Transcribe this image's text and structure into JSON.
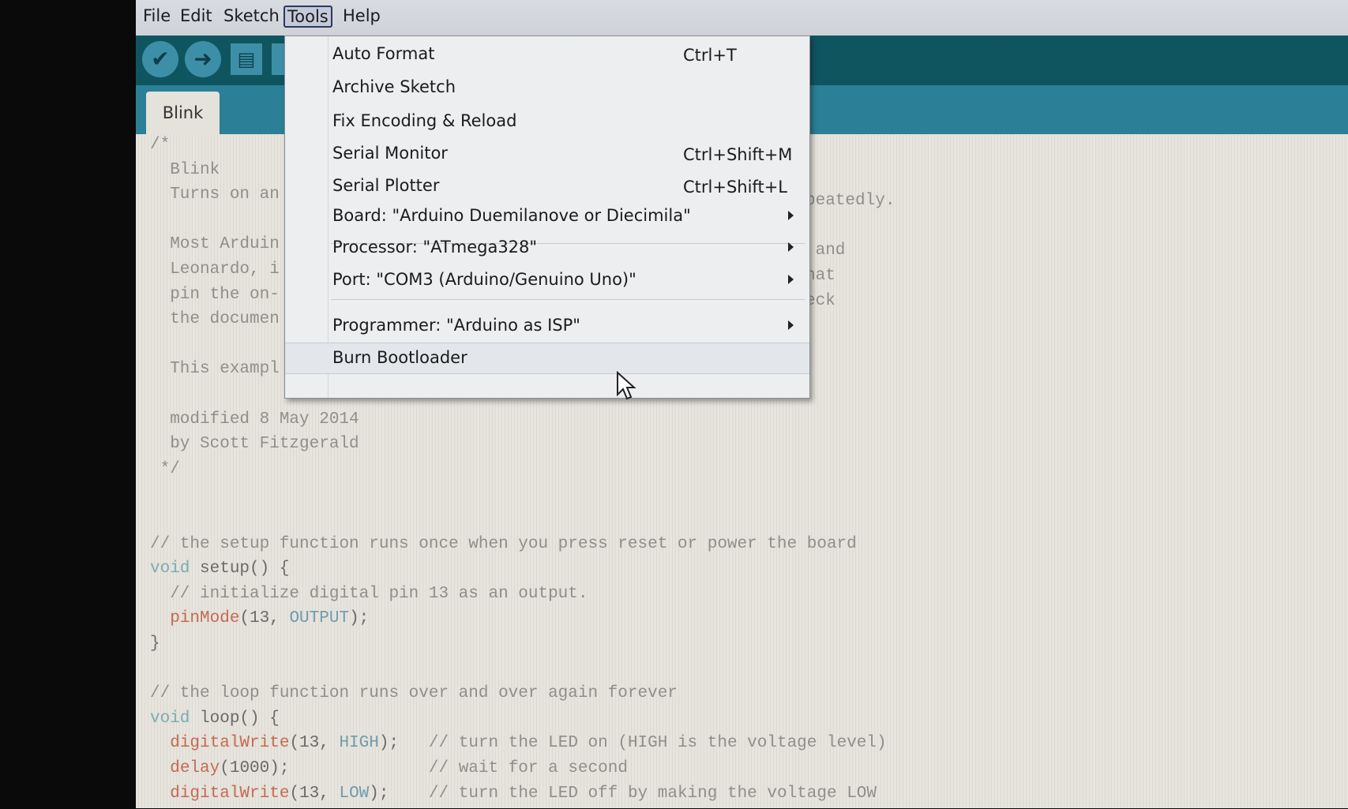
{
  "menubar": {
    "items": [
      "File",
      "Edit",
      "Sketch",
      "Tools",
      "Help"
    ],
    "active": "Tools"
  },
  "toolbar": {
    "verify_icon": "✔",
    "upload_icon": "➜",
    "new_icon": "▤"
  },
  "tab": {
    "label": "Blink"
  },
  "tools_menu": {
    "items": [
      {
        "label": "Auto Format",
        "shortcut": "Ctrl+T"
      },
      {
        "label": "Archive Sketch",
        "shortcut": ""
      },
      {
        "label": "Fix Encoding & Reload",
        "shortcut": ""
      },
      {
        "label": "Serial Monitor",
        "shortcut": "Ctrl+Shift+M"
      },
      {
        "label": "Serial Plotter",
        "shortcut": "Ctrl+Shift+L"
      },
      {
        "label": "Board: \"Arduino Duemilanove or Diecimila\"",
        "shortcut": "",
        "submenu": true
      },
      {
        "label": "Processor: \"ATmega328\"",
        "shortcut": "",
        "submenu": true
      },
      {
        "label": "Port: \"COM3 (Arduino/Genuino Uno)\"",
        "shortcut": "",
        "submenu": true
      },
      {
        "label": "Programmer: \"Arduino as ISP\"",
        "shortcut": "",
        "submenu": true
      },
      {
        "label": "Burn Bootloader",
        "shortcut": "",
        "hovered": true
      }
    ]
  },
  "code": {
    "lines": [
      [
        {
          "t": "/*",
          "k": "comment"
        }
      ],
      [
        {
          "t": "  Blink",
          "k": "comment"
        }
      ],
      [
        {
          "t": "  Turns on an",
          "k": "comment"
        }
      ],
      [],
      [
        {
          "t": "  Most Arduin",
          "k": "comment"
        }
      ],
      [
        {
          "t": "  Leonardo, i",
          "k": "comment"
        }
      ],
      [
        {
          "t": "  pin the on-",
          "k": "comment"
        }
      ],
      [
        {
          "t": "  the documen",
          "k": "comment"
        }
      ],
      [],
      [
        {
          "t": "  This exampl",
          "k": "comment"
        }
      ],
      [],
      [
        {
          "t": "  modified 8 May 2014",
          "k": "comment"
        }
      ],
      [
        {
          "t": "  by Scott Fitzgerald",
          "k": "comment"
        }
      ],
      [
        {
          "t": " */",
          "k": "comment"
        }
      ],
      [],
      [],
      [
        {
          "t": "// the setup function runs once when you press reset or power the board",
          "k": "comment"
        }
      ],
      [
        {
          "t": "void",
          "k": "type"
        },
        {
          "t": " setup() {",
          "k": "plain"
        }
      ],
      [
        {
          "t": "  // initialize digital pin 13 as an output.",
          "k": "comment"
        }
      ],
      [
        {
          "t": "  ",
          "k": "plain"
        },
        {
          "t": "pinMode",
          "k": "func"
        },
        {
          "t": "(13, ",
          "k": "plain"
        },
        {
          "t": "OUTPUT",
          "k": "const"
        },
        {
          "t": ");",
          "k": "plain"
        }
      ],
      [
        {
          "t": "}",
          "k": "plain"
        }
      ],
      [],
      [
        {
          "t": "// the loop function runs over and over again forever",
          "k": "comment"
        }
      ],
      [
        {
          "t": "void",
          "k": "type"
        },
        {
          "t": " loop() {",
          "k": "plain"
        }
      ],
      [
        {
          "t": "  ",
          "k": "plain"
        },
        {
          "t": "digitalWrite",
          "k": "func"
        },
        {
          "t": "(13, ",
          "k": "plain"
        },
        {
          "t": "HIGH",
          "k": "const"
        },
        {
          "t": ");   ",
          "k": "plain"
        },
        {
          "t": "// turn the LED on (HIGH is the voltage level)",
          "k": "comment"
        }
      ],
      [
        {
          "t": "  ",
          "k": "plain"
        },
        {
          "t": "delay",
          "k": "func"
        },
        {
          "t": "(1000);              ",
          "k": "plain"
        },
        {
          "t": "// wait for a second",
          "k": "comment"
        }
      ],
      [
        {
          "t": "  ",
          "k": "plain"
        },
        {
          "t": "digitalWrite",
          "k": "func"
        },
        {
          "t": "(13, ",
          "k": "plain"
        },
        {
          "t": "LOW",
          "k": "const"
        },
        {
          "t": ");    ",
          "k": "plain"
        },
        {
          "t": "// turn the LED off by making the voltage LOW",
          "k": "comment"
        }
      ]
    ],
    "right_fragments": [
      {
        "line": 2,
        "t": "peatedly."
      },
      {
        "line": 4,
        "t": " and"
      },
      {
        "line": 5,
        "t": "hat"
      },
      {
        "line": 6,
        "t": "eck"
      }
    ]
  },
  "colors": {
    "toolbar": "#0f5560",
    "tabbar": "#2b7f96",
    "editor_bg": "#e4e2da",
    "function": "#c46a52",
    "constant": "#6f9cae"
  }
}
